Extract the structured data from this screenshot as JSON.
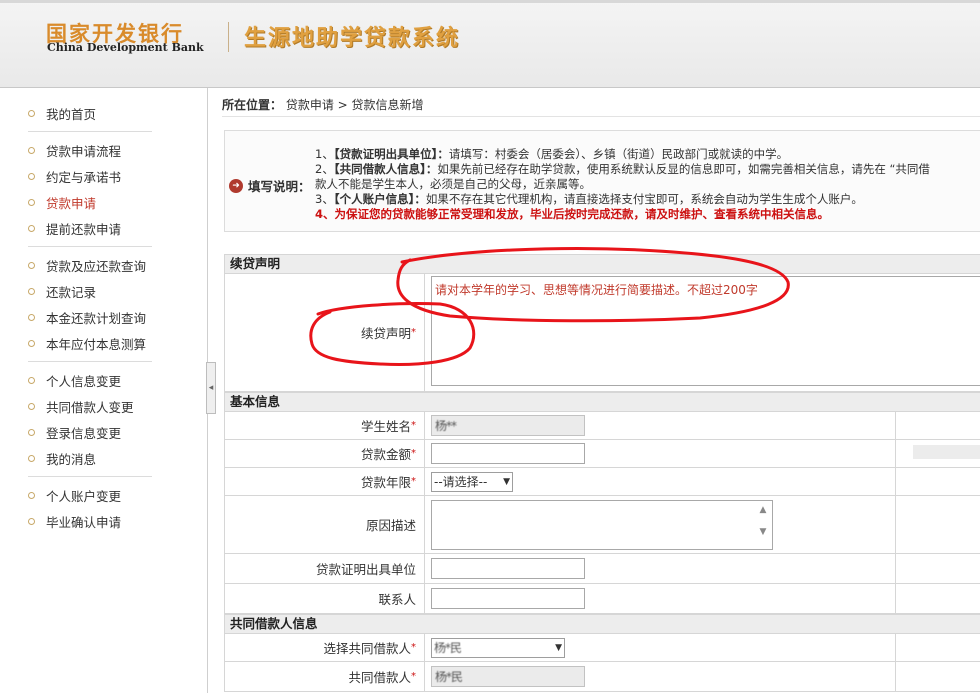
{
  "header": {
    "logo_cn": "国家开发银行",
    "logo_en": "China Development Bank",
    "system_title": "生源地助学贷款系统"
  },
  "sidebar": {
    "groups": [
      [
        {
          "label": "我的首页"
        }
      ],
      [
        {
          "label": "贷款申请流程"
        },
        {
          "label": "约定与承诺书"
        },
        {
          "label": "贷款申请",
          "active": true
        },
        {
          "label": "提前还款申请"
        }
      ],
      [
        {
          "label": "贷款及应还款查询"
        },
        {
          "label": "还款记录"
        },
        {
          "label": "本金还款计划查询"
        },
        {
          "label": "本年应付本息测算"
        }
      ],
      [
        {
          "label": "个人信息变更"
        },
        {
          "label": "共同借款人变更"
        },
        {
          "label": "登录信息变更"
        },
        {
          "label": "我的消息"
        }
      ],
      [
        {
          "label": "个人账户变更"
        },
        {
          "label": "毕业确认申请"
        }
      ]
    ],
    "collapse_glyph": "◂"
  },
  "breadcrumb": {
    "prefix": "所在位置：",
    "path": "贷款申请 > 贷款信息新增"
  },
  "instructions": {
    "label": "填写说明：",
    "lines": [
      {
        "prefix": "1、",
        "bold": "【贷款证明出具单位】：",
        "text": "请填写：村委会（居委会）、乡镇（街道）民政部门或就读的中学。"
      },
      {
        "prefix": "2、",
        "bold": "【共同借款人信息】：",
        "text": "如果先前已经存在助学贷款，使用系统默认反显的信息即可，如需完善相关信息，请先在 “共同借"
      },
      {
        "prefix": "",
        "bold": "",
        "text": "款人不能是学生本人，必须是自己的父母，近亲属等。"
      },
      {
        "prefix": "3、",
        "bold": "【个人账户信息】：",
        "text": "如果不存在其它代理机构，请直接选择支付宝即可，系统会自动为学生生成个人账户。"
      }
    ],
    "warning": "4、为保证您的贷款能够正常受理和发放，毕业后按时完成还款，请及时维护、查看系统中相关信息。"
  },
  "form": {
    "sections": {
      "continuation": "续贷声明",
      "basic": "基本信息",
      "coborrower": "共同借款人信息"
    },
    "continuation_statement": {
      "label": "续贷声明",
      "required": "*",
      "placeholder": "请对本学年的学习、思想等情况进行简要描述。不超过200字"
    },
    "student_name": {
      "label": "学生姓名",
      "required": "*",
      "value": "杨**"
    },
    "loan_amount": {
      "label": "贷款金额",
      "required": "*",
      "value": ""
    },
    "loan_term": {
      "label": "贷款年限",
      "required": "*",
      "selected": "--请选择--"
    },
    "reason": {
      "label": "原因描述",
      "value": ""
    },
    "certifying_unit": {
      "label": "贷款证明出具单位",
      "value": ""
    },
    "contact": {
      "label": "联系人",
      "value": ""
    },
    "select_coborrower": {
      "label": "选择共同借款人",
      "required": "*",
      "selected": "杨*民"
    },
    "coborrower_name": {
      "label": "共同借款人",
      "required": "*",
      "value": "杨*民"
    }
  },
  "annotation_color": "#e8141a"
}
